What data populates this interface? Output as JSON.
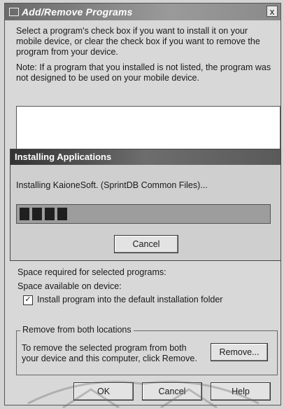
{
  "window": {
    "title": "Add/Remove Programs",
    "close_label": "x"
  },
  "instructions": {
    "line1": "Select a program's check box if you want to install it on your",
    "line2": "mobile device, or clear the check box if you want to remove the",
    "line3": "program from your device.",
    "note1": "Note:  If a program that you installed is not listed, the program was",
    "note2": "not designed to be used on your mobile device."
  },
  "install_dialog": {
    "title": "Installing Applications",
    "status": "Installing KaioneSoft. (SprintDB Common Files)...",
    "progress_blocks": 4,
    "cancel_label": "Cancel"
  },
  "space": {
    "required_label": "Space required for selected programs:",
    "available_label": "Space available on device:"
  },
  "option": {
    "checked": true,
    "check_mark": "✓",
    "label": "Install program into the default installation folder"
  },
  "remove_group": {
    "legend": "Remove from both locations",
    "text1": "To remove the selected program from both",
    "text2": "your device and this computer, click Remove.",
    "remove_label": "Remove..."
  },
  "footer": {
    "ok_label": "OK",
    "cancel_label": "Cancel",
    "help_label": "Help"
  }
}
